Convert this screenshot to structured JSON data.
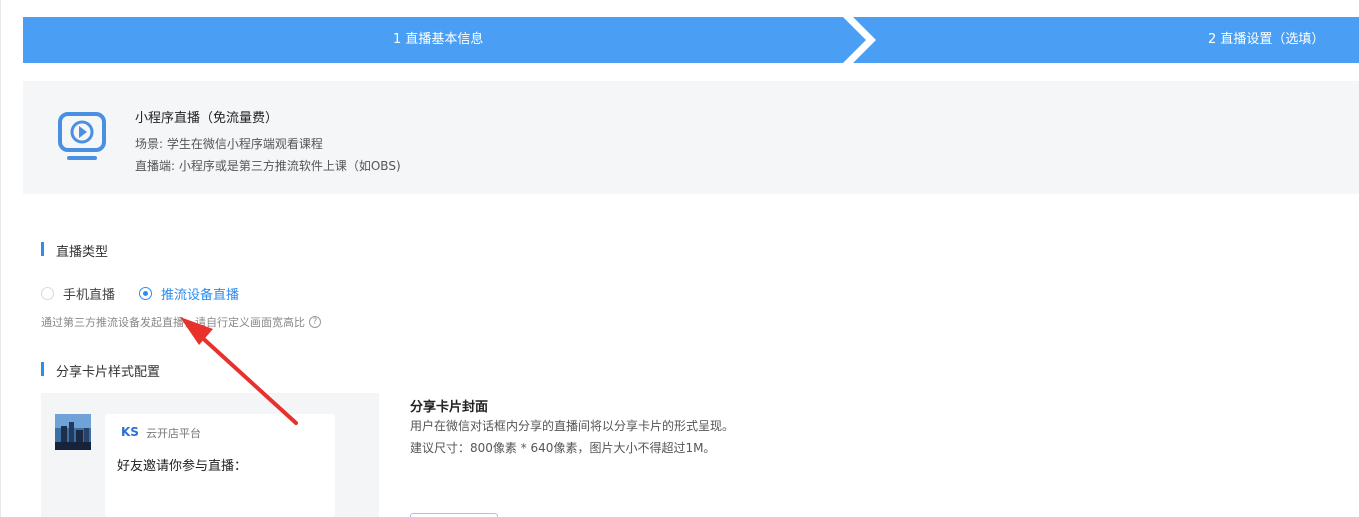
{
  "steps": {
    "step1": "1 直播基本信息",
    "step2": "2 直播设置（选填）",
    "color": "#4a9ff5"
  },
  "info": {
    "icon": "tv-play-icon",
    "title": "小程序直播（免流量费）",
    "scene": "场景: 学生在微信小程序端观看课程",
    "client": "直播端: 小程序或是第三方推流软件上课（如OBS)"
  },
  "live_type": {
    "title": "直播类型",
    "options": [
      {
        "label": "手机直播",
        "checked": false
      },
      {
        "label": "推流设备直播",
        "checked": true
      }
    ],
    "hint": "通过第三方推流设备发起直播，请自行定义画面宽高比",
    "hint_icon": "help-circle-icon"
  },
  "share_card": {
    "title": "分享卡片样式配置",
    "preview": {
      "brand": "KS",
      "shop_name": "云开店平台",
      "invite_text": "好友邀请你参与直播："
    },
    "cover_title": "分享卡片封面",
    "cover_desc": "用户在微信对话框内分享的直播间将以分享卡片的形式呈现。",
    "cover_size": "建议尺寸：800像素 * 640像素，图片大小不得超过1M。"
  },
  "colors": {
    "accent": "#2d8cf0",
    "annotation": "#e8312b"
  }
}
